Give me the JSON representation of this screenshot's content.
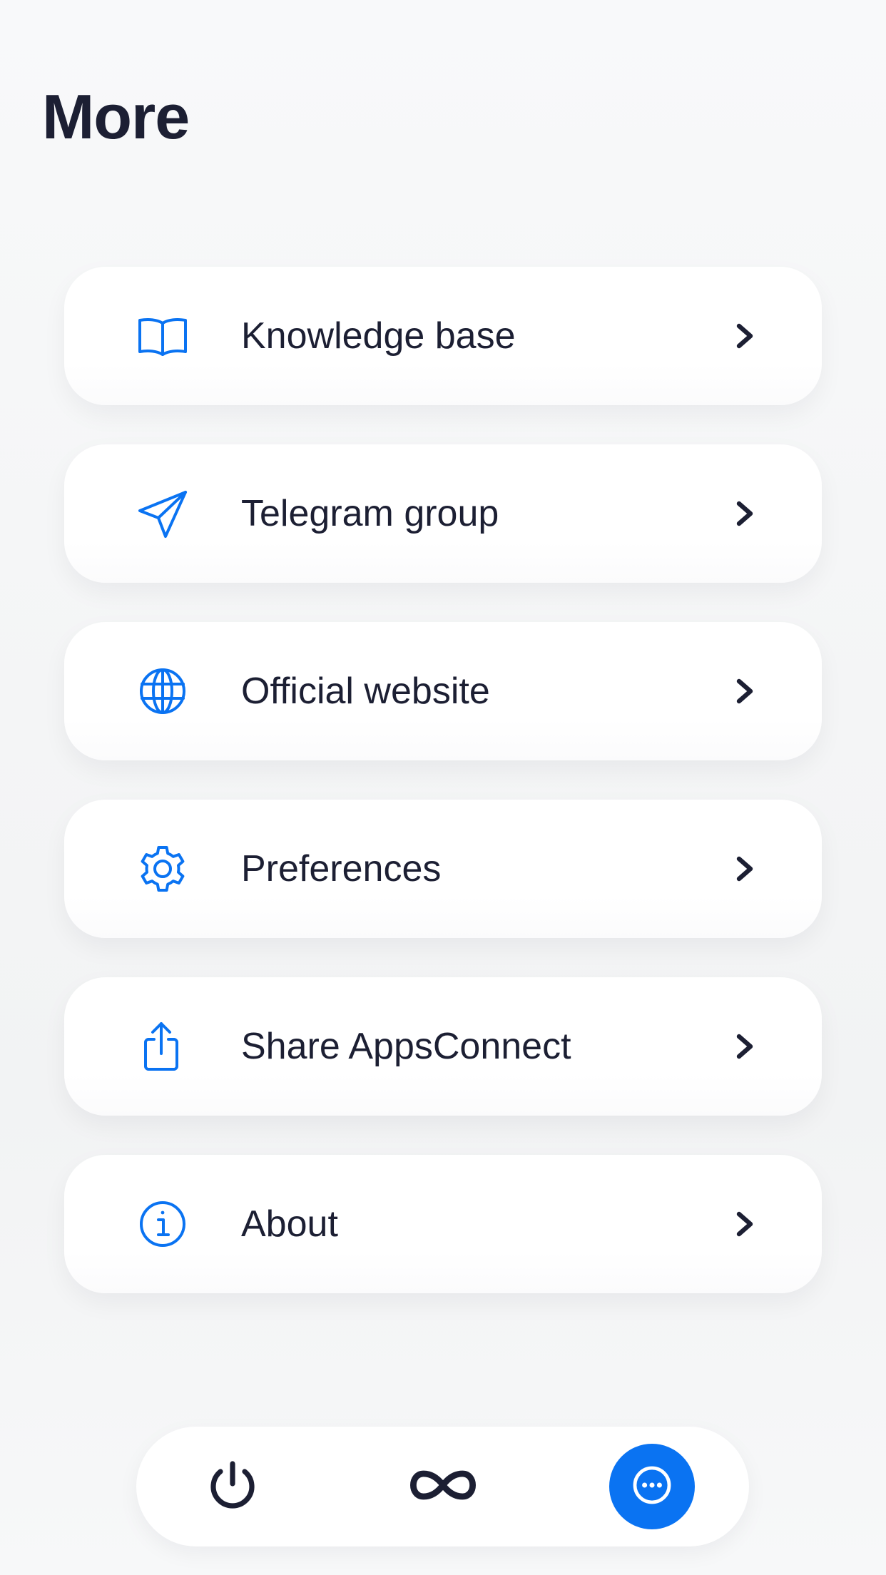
{
  "page": {
    "title": "More"
  },
  "menu": {
    "items": [
      {
        "label": "Knowledge base",
        "icon": "book-icon"
      },
      {
        "label": "Telegram group",
        "icon": "paper-plane-icon"
      },
      {
        "label": "Official website",
        "icon": "globe-icon"
      },
      {
        "label": "Preferences",
        "icon": "gear-icon"
      },
      {
        "label": "Share AppsConnect",
        "icon": "share-icon"
      },
      {
        "label": "About",
        "icon": "info-icon"
      }
    ]
  },
  "tabbar": {
    "tabs": [
      {
        "icon": "power-icon",
        "active": false
      },
      {
        "icon": "infinity-icon",
        "active": false
      },
      {
        "icon": "more-icon",
        "active": true
      }
    ]
  },
  "colors": {
    "accent": "#0a73f2",
    "text": "#1c1f33",
    "background": "#f5f6f7",
    "card": "#ffffff"
  }
}
